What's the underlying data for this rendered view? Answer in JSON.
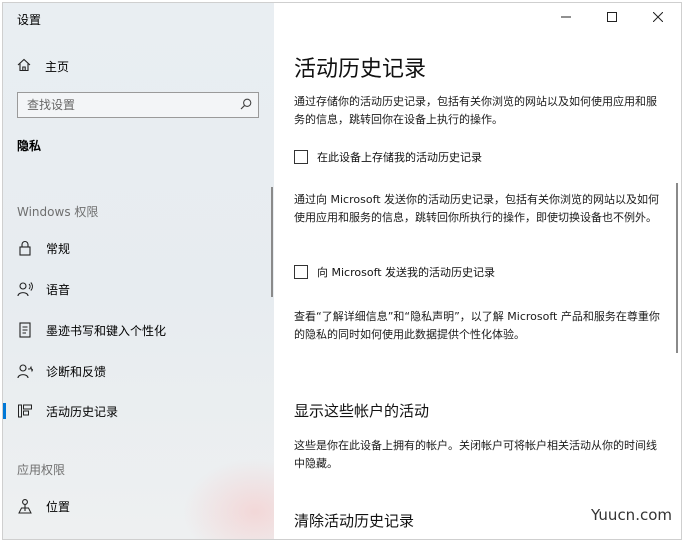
{
  "window": {
    "title": "设置",
    "controls": [
      "minimize",
      "maximize",
      "close"
    ]
  },
  "sidebar": {
    "home_label": "主页",
    "search": {
      "placeholder": "查找设置",
      "value": ""
    },
    "current_section": "隐私",
    "groups": [
      {
        "header": "Windows 权限",
        "items": [
          {
            "label": "常规",
            "icon": "lock-icon"
          },
          {
            "label": "语音",
            "icon": "speech-icon"
          },
          {
            "label": "墨迹书写和键入个性化",
            "icon": "inking-icon"
          },
          {
            "label": "诊断和反馈",
            "icon": "diagnostics-icon"
          },
          {
            "label": "活动历史记录",
            "icon": "activity-history-icon",
            "selected": true
          }
        ]
      },
      {
        "header": "应用权限",
        "items": [
          {
            "label": "位置",
            "icon": "location-icon"
          }
        ]
      }
    ]
  },
  "main": {
    "title": "活动历史记录",
    "intro": "通过存储你的活动历史记录，包括有关你浏览的网站以及如何使用应用和服务的信息，跳转回你在设备上执行的操作。",
    "store_checkbox": {
      "label": "在此设备上存储我的活动历史记录",
      "checked": false
    },
    "send_description": "通过向 Microsoft 发送你的活动历史记录，包括有关你浏览的网站以及如何使用应用和服务的信息，跳转回你所执行的操作，即使切换设备也不例外。",
    "send_checkbox": {
      "label": "向 Microsoft 发送我的活动历史记录",
      "checked": false
    },
    "privacy_note": "查看“了解详细信息”和“隐私声明”，以了解 Microsoft 产品和服务在尊重你的隐私的同时如何使用此数据提供个性化体验。",
    "accounts_section": {
      "title": "显示这些帐户的活动",
      "description": "这些是你在此设备上拥有的帐户。关闭帐户可将帐户相关活动从你的时间线中隐藏。"
    },
    "clear_section": {
      "title": "清除活动历史记录"
    }
  },
  "watermark": "Yuucn.com"
}
